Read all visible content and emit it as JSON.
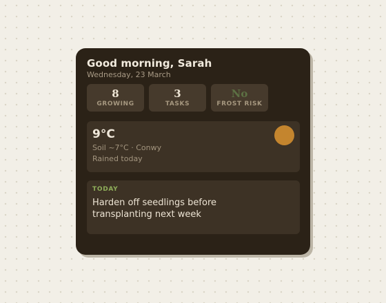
{
  "header": {
    "greeting": "Good morning, Sarah",
    "date": "Wednesday, 23 March"
  },
  "stats": [
    {
      "value": "8",
      "label": "GROWING"
    },
    {
      "value": "3",
      "label": "TASKS"
    },
    {
      "value": "No",
      "label": "FROST RISK"
    }
  ],
  "weather": {
    "temperature": "9°C",
    "soil_location": "Soil ~7°C · Conwy",
    "condition_note": "Rained today",
    "icon": "sun-icon"
  },
  "today": {
    "label": "TODAY",
    "tip": "Harden off seedlings before transplanting next week"
  },
  "colors": {
    "background": "#f2efe7",
    "card": "#2b2217",
    "tile": "#463a2c",
    "panel": "#3d3225",
    "sun": "#c4852e",
    "accent_green": "#8fae5a",
    "frost_value": "#5c7043"
  }
}
